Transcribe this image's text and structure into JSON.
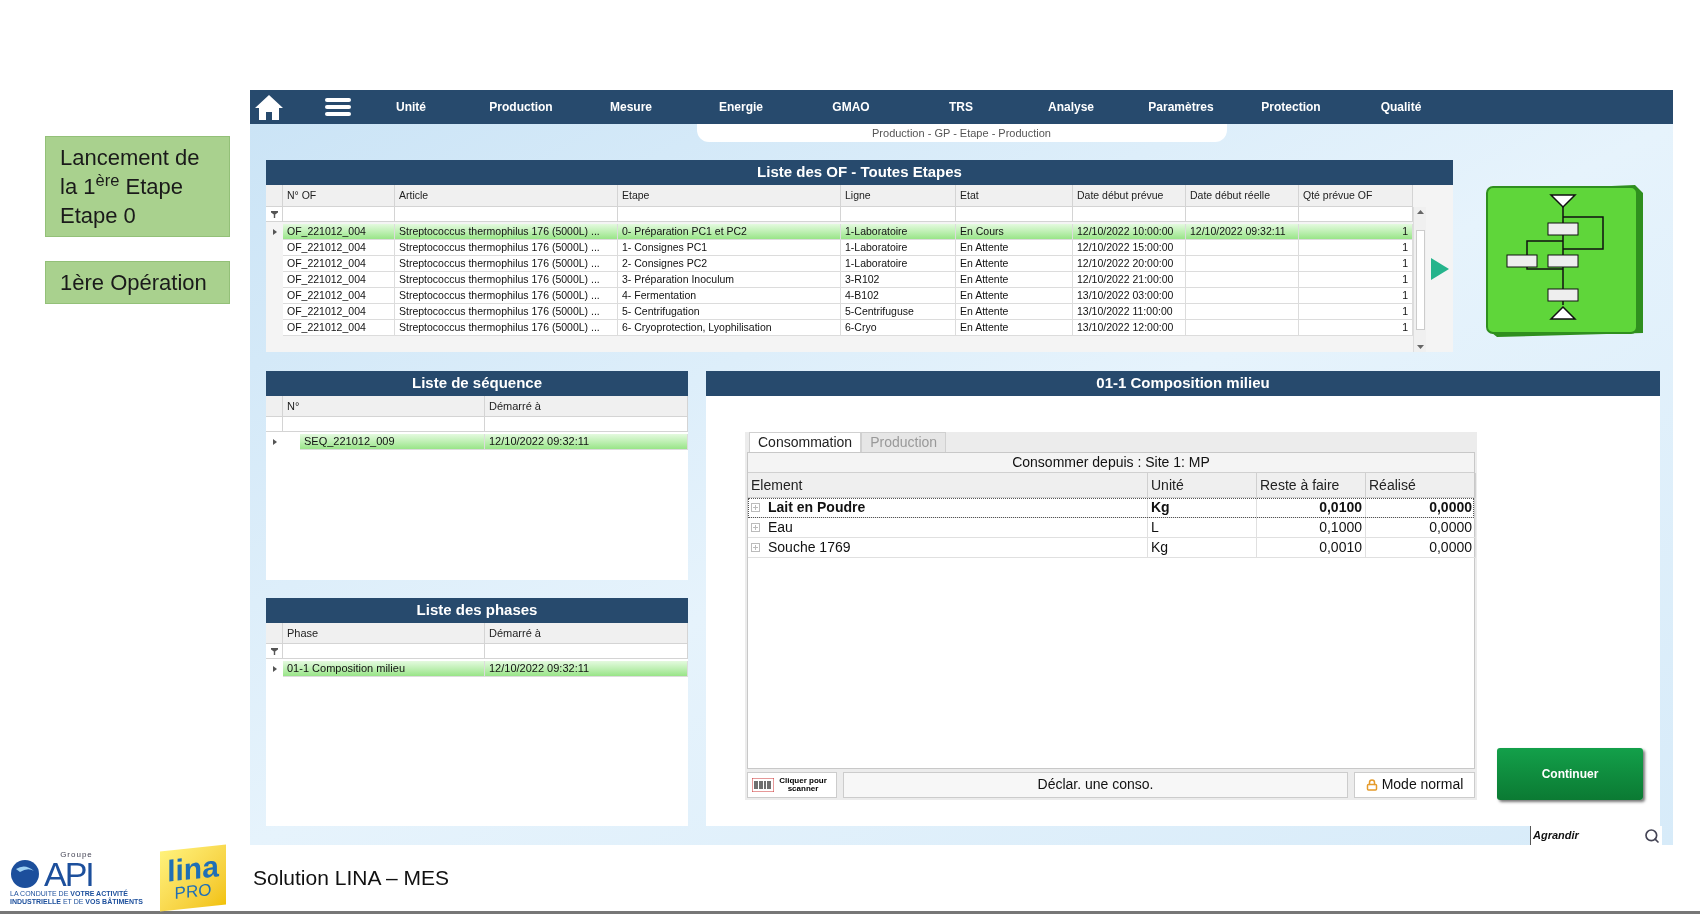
{
  "side_labels": [
    {
      "text": "Lancement de la 1$^{ère}$ Etape\nEtape 0"
    },
    {
      "text": "1ère Opération"
    }
  ],
  "nav": {
    "items": [
      "Unité",
      "Production",
      "Mesure",
      "Energie",
      "GMAO",
      "TRS",
      "Analyse",
      "Paramètres",
      "Protection",
      "Qualité"
    ]
  },
  "breadcrumb": "Production - GP - Etape - Production",
  "of_panel": {
    "title": "Liste des OF - Toutes Etapes",
    "filter_icon": true,
    "columns": [
      "N° OF",
      "Article",
      "Etape",
      "Ligne",
      "Etat",
      "Date début prévue",
      "Date début réelle",
      "Qté prévue OF"
    ],
    "rows": [
      {
        "cells": [
          "OF_221012_004",
          "Streptococcus thermophilus 176 (5000L) ...",
          "0- Préparation PC1 et PC2",
          "1-Laboratoire",
          "En Cours",
          "12/10/2022 10:00:00",
          "12/10/2022 09:32:11",
          "1"
        ],
        "selected": true
      },
      {
        "cells": [
          "OF_221012_004",
          "Streptococcus thermophilus 176 (5000L) ...",
          "1- Consignes PC1",
          "1-Laboratoire",
          "En Attente",
          "12/10/2022 15:00:00",
          "",
          "1"
        ],
        "selected": false
      },
      {
        "cells": [
          "OF_221012_004",
          "Streptococcus thermophilus 176 (5000L) ...",
          "2- Consignes PC2",
          "1-Laboratoire",
          "En Attente",
          "12/10/2022 20:00:00",
          "",
          "1"
        ],
        "selected": false
      },
      {
        "cells": [
          "OF_221012_004",
          "Streptococcus thermophilus 176 (5000L) ...",
          "3- Préparation Inoculum",
          "3-R102",
          "En Attente",
          "12/10/2022 21:00:00",
          "",
          "1"
        ],
        "selected": false
      },
      {
        "cells": [
          "OF_221012_004",
          "Streptococcus thermophilus 176 (5000L) ...",
          "4- Fermentation",
          "4-B102",
          "En Attente",
          "13/10/2022 03:00:00",
          "",
          "1"
        ],
        "selected": false
      },
      {
        "cells": [
          "OF_221012_004",
          "Streptococcus thermophilus 176 (5000L) ...",
          "5- Centrifugation",
          "5-Centrifuguse",
          "En Attente",
          "13/10/2022 11:00:00",
          "",
          "1"
        ],
        "selected": false
      },
      {
        "cells": [
          "OF_221012_004",
          "Streptococcus thermophilus 176 (5000L) ...",
          "6- Cryoprotection, Lyophilisation",
          "6-Cryo",
          "En Attente",
          "13/10/2022 12:00:00",
          "",
          "1"
        ],
        "selected": false
      }
    ]
  },
  "sequence_panel": {
    "title": "Liste de séquence",
    "filter_icon": false,
    "columns": [
      "N°",
      "Démarré à"
    ],
    "rows": [
      {
        "cells": [
          "SEQ_221012_009",
          "12/10/2022 09:32:11"
        ],
        "selected": true
      }
    ]
  },
  "phases_panel": {
    "title": "Liste des phases",
    "filter_icon": true,
    "columns": [
      "Phase",
      "Démarré à"
    ],
    "rows": [
      {
        "cells": [
          "01-1 Composition milieu",
          "12/10/2022 09:32:11"
        ],
        "selected": true
      }
    ]
  },
  "composition_panel": {
    "title": "01-1 Composition milieu",
    "tabs": [
      {
        "label": "Consommation",
        "selected": true
      },
      {
        "label": "Production",
        "selected": false
      }
    ],
    "source": "Consommer depuis : Site 1: MP",
    "columns": [
      "Element",
      "Unité",
      "Reste à faire",
      "Réalisé"
    ],
    "rows": [
      {
        "cells": [
          "Lait en Poudre",
          "Kg",
          "0,0100",
          "0,0000"
        ],
        "selected": true
      },
      {
        "cells": [
          "Eau",
          "L",
          "0,1000",
          "0,0000"
        ],
        "selected": false
      },
      {
        "cells": [
          "Souche 1769",
          "Kg",
          "0,0010",
          "0,0000"
        ],
        "selected": false
      }
    ],
    "scan_button": "Cliquer pour scanner",
    "declare_field": "Déclar. une conso.",
    "mode_button": "Mode normal",
    "continue_button": "Continuer"
  },
  "zoom_field": {
    "value": "Agrandir"
  },
  "footer": {
    "api_group": "Groupe",
    "api_name": "API",
    "api_tagline": "LA CONDUITE DE **VOTRE ACTIVITÉ** **INDUSTRIELLE** ET DE **VOS BÂTIMENTS**",
    "lina_name": "lina",
    "lina_sub": "PRO",
    "title": "Solution LINA – MES"
  }
}
